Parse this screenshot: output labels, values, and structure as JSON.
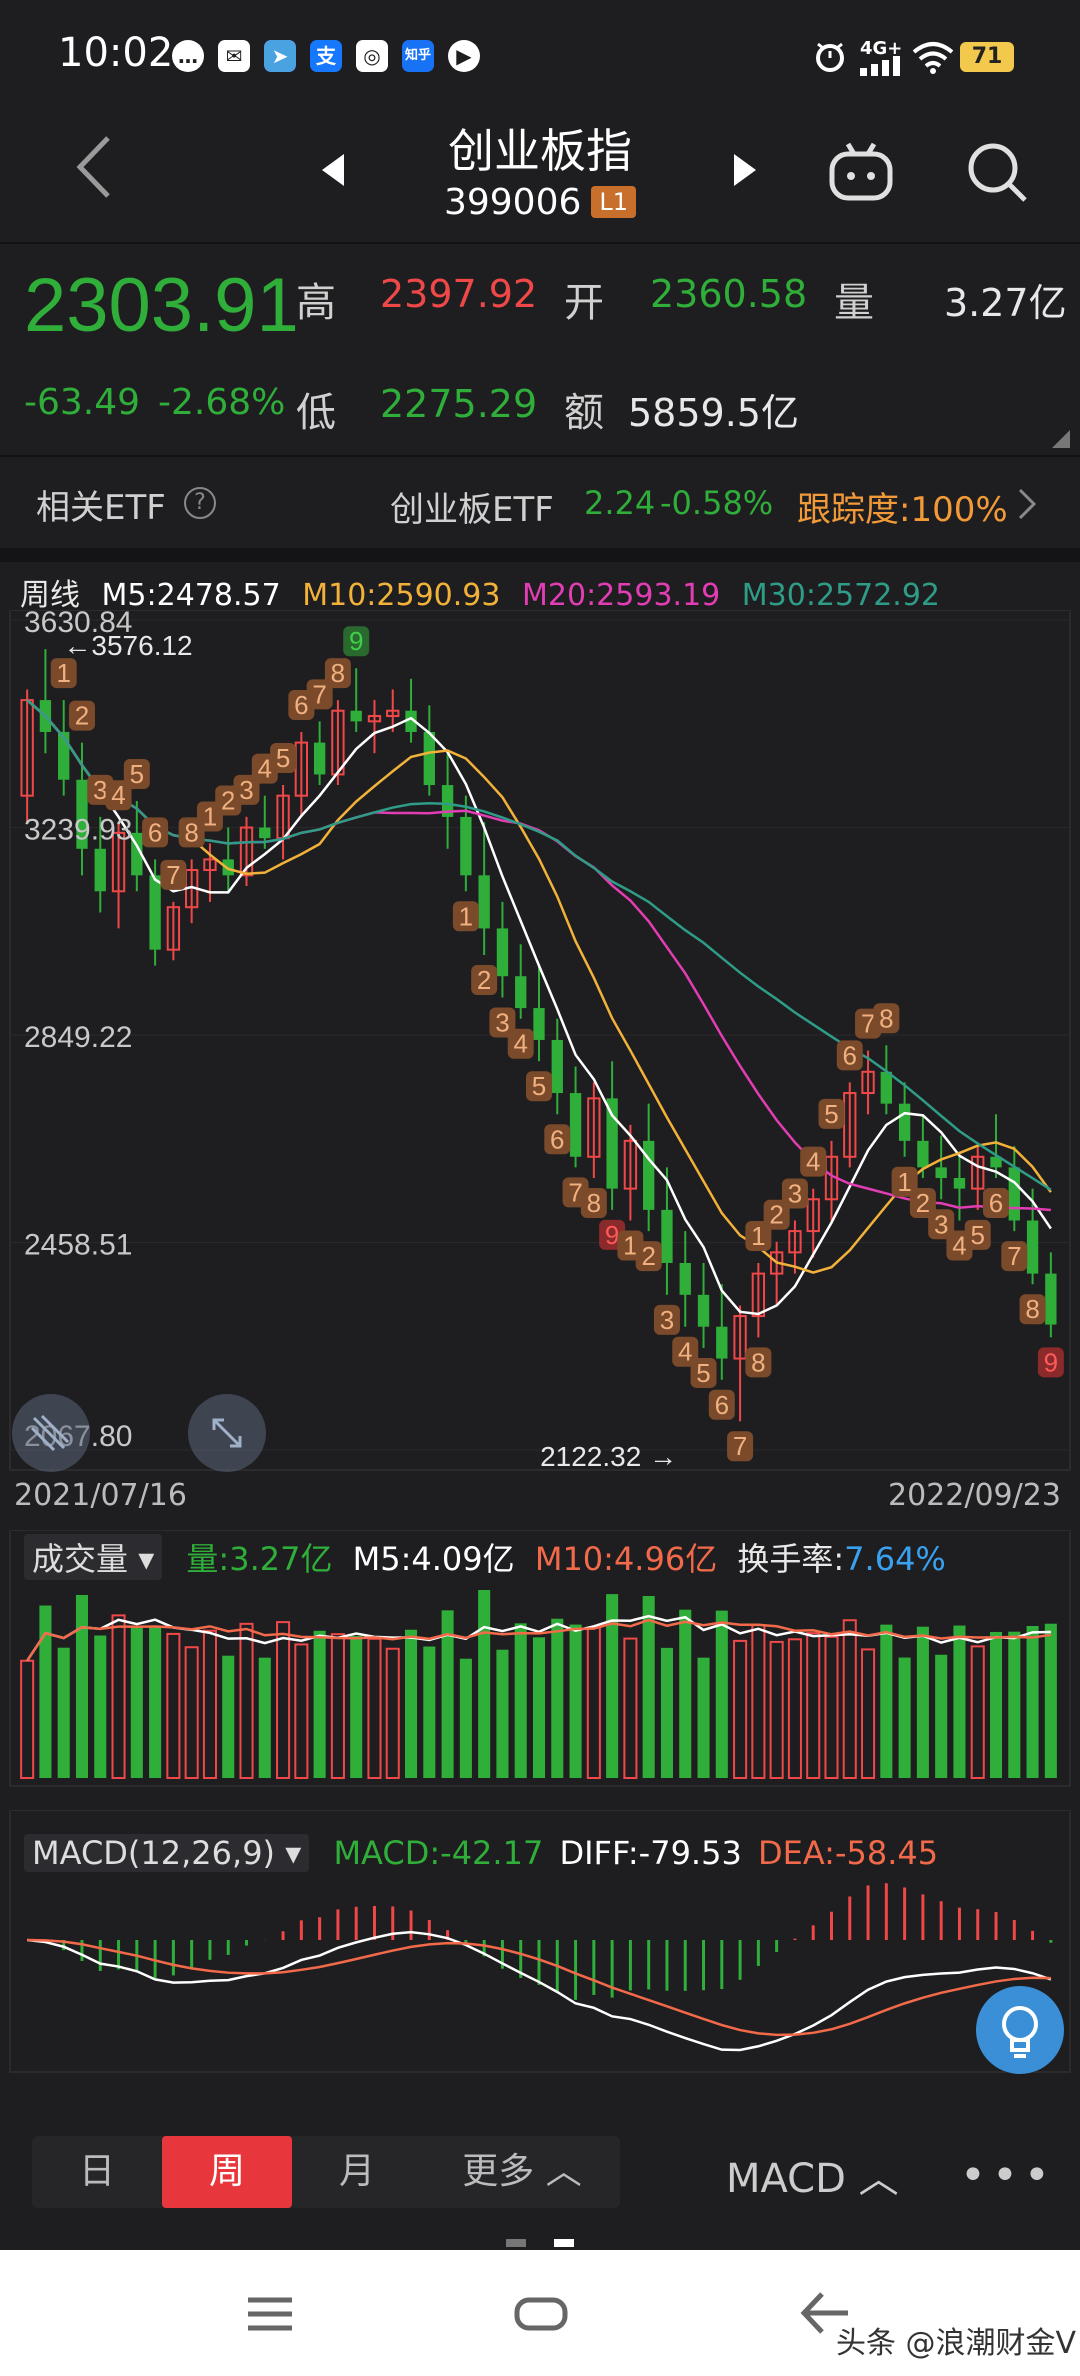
{
  "status": {
    "time": "10:02",
    "network": "4G+",
    "battery": "71"
  },
  "header": {
    "title": "创业板指",
    "code": "399006",
    "level": "L1"
  },
  "quote": {
    "price": "2303.91",
    "change": "-63.49",
    "change_pct": "-2.68%",
    "high_label": "高",
    "high": "2397.92",
    "open_label": "开",
    "open": "2360.58",
    "volume_label": "量",
    "volume": "3.27亿",
    "low_label": "低",
    "low": "2275.29",
    "amount_label": "额",
    "amount": "5859.5亿"
  },
  "etf": {
    "label": "相关ETF",
    "name": "创业板ETF",
    "price": "2.24",
    "change": "-0.58%",
    "tracking": "跟踪度:100%"
  },
  "ma_legend": {
    "period": "周线",
    "m5": "M5:2478.57",
    "m10": "M10:2590.93",
    "m20": "M20:2593.19",
    "m30": "M30:2572.92"
  },
  "kline": {
    "y_labels": [
      "3630.84",
      "3239.93",
      "2849.22",
      "2458.51",
      "2067.80"
    ],
    "max_label": "3576.12",
    "min_label": "2122.32",
    "start_date": "2021/07/16",
    "end_date": "2022/09/23"
  },
  "volume_panel": {
    "selector": "成交量",
    "vol": "量:3.27亿",
    "m5": "M5:4.09亿",
    "m10": "M10:4.96亿",
    "turnover_label": "换手率:",
    "turnover": "7.64%"
  },
  "macd_panel": {
    "selector": "MACD(12,26,9)",
    "macd": "MACD:-42.17",
    "diff": "DIFF:-79.53",
    "dea": "DEA:-58.45"
  },
  "period_tabs": [
    "日",
    "周",
    "月",
    "更多"
  ],
  "indicator_select": "MACD",
  "watermark": "头条 @浪潮财金V",
  "colors": {
    "up": "#f04848",
    "down": "#2fae3a",
    "m5": "#ffffff",
    "m10": "#f2b23a",
    "m20": "#e23db3",
    "m30": "#2e9c86",
    "accent": "#e8373c"
  },
  "chart_data": {
    "type": "candlestick",
    "x_range": [
      "2021/07/16",
      "2022/09/23"
    ],
    "ylim": [
      2067.8,
      3630.84
    ],
    "y_ticks": [
      3630.84,
      3239.93,
      2849.22,
      2458.51,
      2067.8
    ],
    "candles": [
      [
        3300,
        3500,
        3250,
        3480
      ],
      [
        3480,
        3576,
        3380,
        3420
      ],
      [
        3420,
        3480,
        3300,
        3330
      ],
      [
        3330,
        3400,
        3150,
        3200
      ],
      [
        3200,
        3260,
        3080,
        3120
      ],
      [
        3120,
        3250,
        3050,
        3230
      ],
      [
        3230,
        3290,
        3120,
        3150
      ],
      [
        3150,
        3180,
        2980,
        3010
      ],
      [
        3010,
        3100,
        2990,
        3090
      ],
      [
        3090,
        3180,
        3060,
        3160
      ],
      [
        3160,
        3210,
        3100,
        3180
      ],
      [
        3180,
        3240,
        3120,
        3150
      ],
      [
        3150,
        3260,
        3130,
        3240
      ],
      [
        3240,
        3300,
        3200,
        3220
      ],
      [
        3220,
        3320,
        3180,
        3300
      ],
      [
        3300,
        3420,
        3260,
        3400
      ],
      [
        3400,
        3440,
        3320,
        3340
      ],
      [
        3340,
        3480,
        3320,
        3460
      ],
      [
        3460,
        3540,
        3420,
        3440
      ],
      [
        3440,
        3480,
        3380,
        3450
      ],
      [
        3450,
        3500,
        3420,
        3460
      ],
      [
        3460,
        3520,
        3400,
        3420
      ],
      [
        3420,
        3470,
        3300,
        3320
      ],
      [
        3320,
        3380,
        3200,
        3260
      ],
      [
        3260,
        3300,
        3120,
        3150
      ],
      [
        3150,
        3250,
        3000,
        3050
      ],
      [
        3050,
        3100,
        2920,
        2960
      ],
      [
        2960,
        3020,
        2880,
        2900
      ],
      [
        2900,
        2980,
        2800,
        2840
      ],
      [
        2840,
        2880,
        2700,
        2740
      ],
      [
        2740,
        2790,
        2600,
        2620
      ],
      [
        2620,
        2760,
        2580,
        2730
      ],
      [
        2730,
        2800,
        2520,
        2560
      ],
      [
        2560,
        2680,
        2500,
        2650
      ],
      [
        2650,
        2720,
        2480,
        2520
      ],
      [
        2520,
        2600,
        2360,
        2420
      ],
      [
        2420,
        2480,
        2300,
        2360
      ],
      [
        2360,
        2420,
        2260,
        2300
      ],
      [
        2300,
        2380,
        2200,
        2240
      ],
      [
        2240,
        2340,
        2122,
        2320
      ],
      [
        2320,
        2420,
        2280,
        2400
      ],
      [
        2400,
        2460,
        2340,
        2440
      ],
      [
        2440,
        2500,
        2400,
        2480
      ],
      [
        2480,
        2560,
        2430,
        2540
      ],
      [
        2540,
        2650,
        2500,
        2620
      ],
      [
        2620,
        2760,
        2600,
        2740
      ],
      [
        2740,
        2820,
        2700,
        2780
      ],
      [
        2780,
        2830,
        2700,
        2720
      ],
      [
        2720,
        2760,
        2620,
        2650
      ],
      [
        2650,
        2700,
        2580,
        2600
      ],
      [
        2600,
        2660,
        2540,
        2580
      ],
      [
        2580,
        2630,
        2500,
        2560
      ],
      [
        2560,
        2640,
        2520,
        2620
      ],
      [
        2620,
        2700,
        2580,
        2600
      ],
      [
        2600,
        2640,
        2480,
        2500
      ],
      [
        2500,
        2560,
        2380,
        2400
      ],
      [
        2400,
        2440,
        2280,
        2304
      ]
    ]
  }
}
